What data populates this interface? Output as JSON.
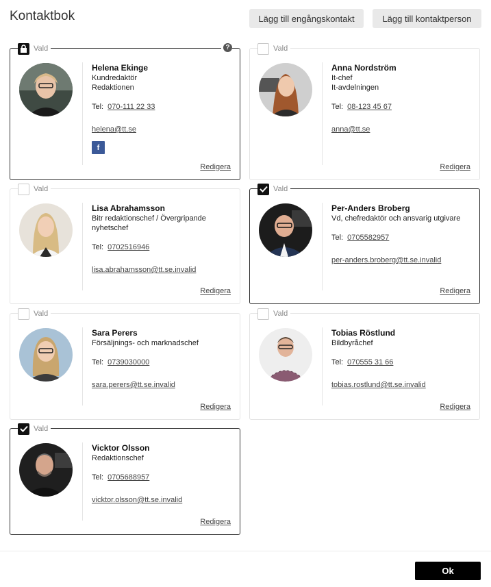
{
  "header": {
    "title": "Kontaktbok",
    "add_single_label": "Lägg till engångskontakt",
    "add_person_label": "Lägg till kontaktperson"
  },
  "common": {
    "selected_label": "Vald",
    "tel_label": "Tel:",
    "edit_label": "Redigera",
    "help_glyph": "?",
    "facebook_glyph": "f"
  },
  "contacts": [
    {
      "name": "Helena Ekinge",
      "role_line1": "Kundredaktör",
      "role_line2": "Redaktionen",
      "phone": "070-111 22 33",
      "email": "helena@tt.se",
      "state": "locked",
      "facebook": true
    },
    {
      "name": "Anna Nordström",
      "role_line1": "It-chef",
      "role_line2": "It-avdelningen",
      "phone": "08-123 45 67",
      "email": "anna@tt.se",
      "state": "unchecked",
      "facebook": false
    },
    {
      "name": "Lisa Abrahamsson",
      "role_line1": "Bitr redaktionschef / Övergripande",
      "role_line2": "nyhetschef",
      "phone": "0702516946",
      "email": "lisa.abrahamsson@tt.se.invalid",
      "state": "unchecked",
      "facebook": false
    },
    {
      "name": "Per-Anders Broberg",
      "role_line1": "Vd, chefredaktör och ansvarig utgivare",
      "role_line2": "",
      "phone": "0705582957",
      "email": "per-anders.broberg@tt.se.invalid",
      "state": "checked",
      "facebook": false
    },
    {
      "name": "Sara Perers",
      "role_line1": "Försäljnings- och marknadschef",
      "role_line2": "",
      "phone": "0739030000",
      "email": "sara.perers@tt.se.invalid",
      "state": "unchecked",
      "facebook": false
    },
    {
      "name": "Tobias Röstlund",
      "role_line1": "Bildbyråchef",
      "role_line2": "",
      "phone": "070555 31 66",
      "email": "tobias.rostlund@tt.se.invalid",
      "state": "unchecked",
      "facebook": false
    },
    {
      "name": "Vicktor Olsson",
      "role_line1": "Redaktionschef",
      "role_line2": "",
      "phone": "0705688957",
      "email": "vicktor.olsson@tt.se.invalid",
      "state": "checked",
      "facebook": false
    }
  ],
  "footer": {
    "ok_label": "Ok"
  },
  "colors": {
    "selected_border": "#333333",
    "default_border": "#e4e4e4",
    "facebook": "#3b5998",
    "ok_bg": "#000000"
  }
}
